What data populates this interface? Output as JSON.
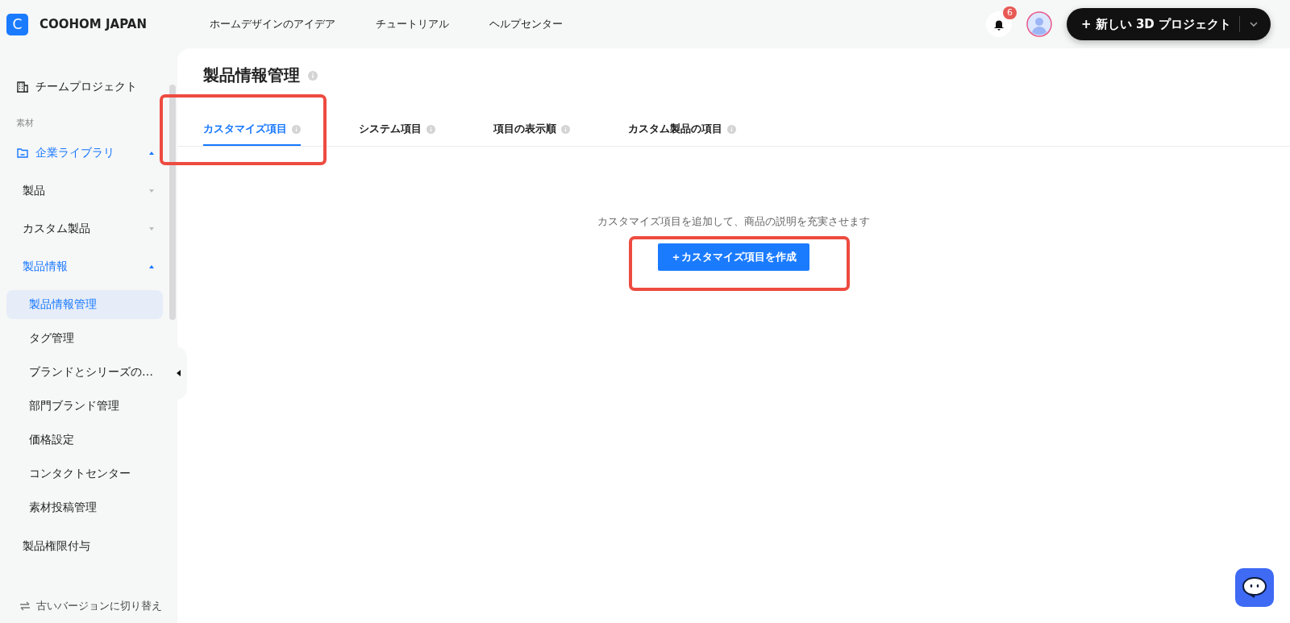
{
  "header": {
    "logo_letter": "C",
    "brand": "COOHOM JAPAN",
    "nav": [
      "ホームデザインのアイデア",
      "チュートリアル",
      "ヘルプセンター"
    ],
    "notification_count": "6",
    "new_project_button": "+ 新しい 3D プロジェクト"
  },
  "sidebar": {
    "items": [
      {
        "kind": "link",
        "label": "チームプロジェクト"
      },
      {
        "kind": "section",
        "label": "素材"
      },
      {
        "kind": "folder",
        "label": "企業ライブラリ",
        "expanded": true,
        "children": [
          {
            "label": "製品",
            "expanded": false
          },
          {
            "label": "カスタム製品",
            "expanded": false
          },
          {
            "label": "製品情報",
            "expanded": true,
            "children": [
              {
                "label": "製品情報管理",
                "selected": true
              },
              {
                "label": "タグ管理",
                "selected": false
              },
              {
                "label": "ブランドとシリーズの…",
                "selected": false
              },
              {
                "label": "部門ブランド管理",
                "selected": false
              },
              {
                "label": "価格設定",
                "selected": false
              },
              {
                "label": "コンタクトセンター",
                "selected": false
              },
              {
                "label": "素材投稿管理",
                "selected": false
              }
            ]
          },
          {
            "label": "製品権限付与"
          }
        ]
      }
    ],
    "footer_link": "古いバージョンに切り替え"
  },
  "page": {
    "title": "製品情報管理",
    "tabs": [
      {
        "label": "カスタマイズ項目",
        "selected": true,
        "highlighted": true
      },
      {
        "label": "システム項目",
        "selected": false,
        "highlighted": false
      },
      {
        "label": "項目の表示順",
        "selected": false,
        "highlighted": false
      },
      {
        "label": "カスタム製品の項目",
        "selected": false,
        "highlighted": false
      }
    ],
    "empty_message": "カスタマイズ項目を追加して、商品の説明を充実させます",
    "create_button": {
      "label": "＋カスタマイズ項目を作成",
      "highlighted": true
    }
  }
}
